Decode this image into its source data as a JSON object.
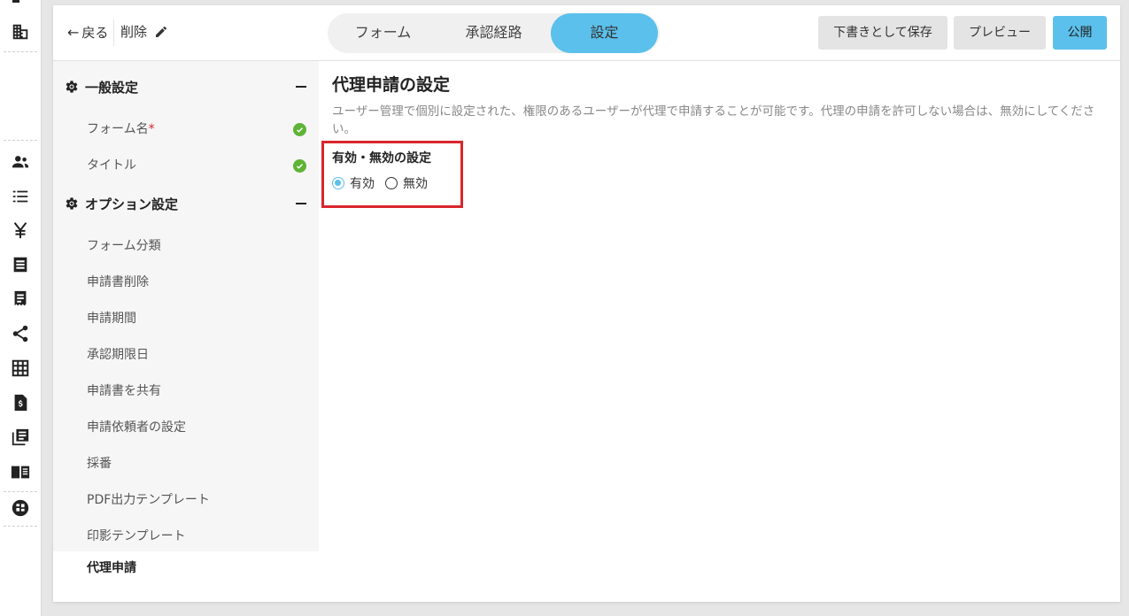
{
  "rail": {
    "icons": [
      "building-icon",
      "users-icon",
      "list-icon",
      "yen-icon",
      "document-icon",
      "receipt-icon",
      "share-icon",
      "grid-icon",
      "invoice-icon",
      "library-icon",
      "book-icon",
      "dashboard-icon"
    ]
  },
  "header": {
    "back_label": "戻る",
    "back_arrow": "←",
    "form_name": "削除",
    "tabs": [
      {
        "label": "フォーム"
      },
      {
        "label": "承認経路"
      },
      {
        "label": "設定"
      }
    ],
    "active_tab": "設定",
    "draft_label": "下書きとして保存",
    "preview_label": "プレビュー",
    "publish_label": "公開",
    "accent_color": "#5bc0eb"
  },
  "sidebar": {
    "general": {
      "title": "一般設定",
      "items": [
        {
          "label": "フォーム名",
          "required_mark": "*",
          "complete": true
        },
        {
          "label": "タイトル",
          "complete": true
        }
      ]
    },
    "options": {
      "title": "オプション設定",
      "items": [
        {
          "label": "フォーム分類"
        },
        {
          "label": "申請書削除"
        },
        {
          "label": "申請期間"
        },
        {
          "label": "承認期限日"
        },
        {
          "label": "申請書を共有"
        },
        {
          "label": "申請依頼者の設定"
        },
        {
          "label": "採番"
        },
        {
          "label": "PDF出力テンプレート"
        },
        {
          "label": "印影テンプレート"
        },
        {
          "label": "代理申請",
          "active": true
        }
      ]
    }
  },
  "main": {
    "title": "代理申請の設定",
    "description": "ユーザー管理で個別に設定された、権限のあるユーザーが代理で申請することが可能です。代理の申請を許可しない場合は、無効にしてください。",
    "option_title": "有効・無効の設定",
    "radio_enabled": "有効",
    "radio_disabled": "無効",
    "selected": "有効",
    "highlight_color": "#d9262c"
  }
}
